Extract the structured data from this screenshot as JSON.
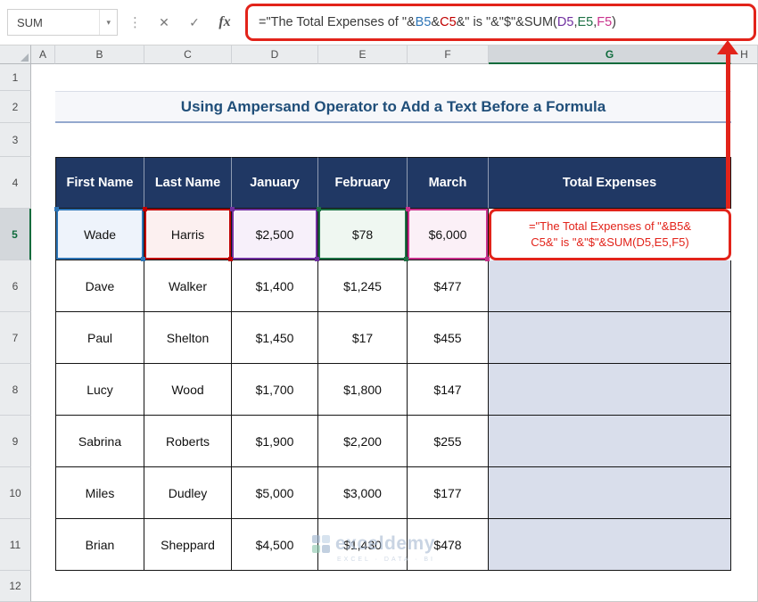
{
  "formula_bar": {
    "name_box_value": "SUM",
    "name_box_caret": "▾",
    "separator_dots": "⋮",
    "cancel_icon": "✕",
    "enter_icon": "✓",
    "fx_icon": "fx",
    "formula_segments": [
      {
        "text": "=\"The Total Expenses of \"&",
        "color": "plain"
      },
      {
        "text": "B5",
        "color": "blue"
      },
      {
        "text": "&",
        "color": "plain"
      },
      {
        "text": "C5",
        "color": "red"
      },
      {
        "text": "&\" is \"&\"$\"&SUM(",
        "color": "plain"
      },
      {
        "text": "D5",
        "color": "purple"
      },
      {
        "text": ",",
        "color": "plain"
      },
      {
        "text": "E5",
        "color": "green"
      },
      {
        "text": ",",
        "color": "plain"
      },
      {
        "text": "F5",
        "color": "magenta"
      },
      {
        "text": ")",
        "color": "plain"
      }
    ]
  },
  "sheet": {
    "col_headers": [
      "A",
      "B",
      "C",
      "D",
      "E",
      "F",
      "G",
      "H"
    ],
    "row_headers": [
      "1",
      "2",
      "3",
      "4",
      "5",
      "6",
      "7",
      "8",
      "9",
      "10",
      "11",
      "12"
    ],
    "selected_column": "G",
    "selected_row": "5",
    "title": "Using Ampersand Operator to Add a Text Before a Formula",
    "table": {
      "headers": [
        "First Name",
        "Last Name",
        "January",
        "February",
        "March",
        "Total Expenses"
      ],
      "rows": [
        {
          "first": "Wade",
          "last": "Harris",
          "january": "$2,500",
          "february": "$78",
          "march": "$6,000"
        },
        {
          "first": "Dave",
          "last": "Walker",
          "january": "$1,400",
          "february": "$1,245",
          "march": "$477"
        },
        {
          "first": "Paul",
          "last": "Shelton",
          "january": "$1,450",
          "february": "$17",
          "march": "$455"
        },
        {
          "first": "Lucy",
          "last": "Wood",
          "january": "$1,700",
          "february": "$1,800",
          "march": "$147"
        },
        {
          "first": "Sabrina",
          "last": "Roberts",
          "january": "$1,900",
          "february": "$2,200",
          "march": "$255"
        },
        {
          "first": "Miles",
          "last": "Dudley",
          "january": "$5,000",
          "february": "$3,000",
          "march": "$177"
        },
        {
          "first": "Brian",
          "last": "Sheppard",
          "january": "$4,500",
          "february": "$1,430",
          "march": "$478"
        }
      ]
    },
    "g5_cell": {
      "line1": "=\"The Total Expenses of \"&B5&",
      "line2": "C5&\" is \"&\"$\"&SUM(D5,E5,F5)"
    }
  },
  "watermark": {
    "brand": "exceldemy",
    "tagline": "EXCEL · DATA · BI"
  },
  "colors": {
    "annotation_red": "#E2231A",
    "table_header_navy": "#203864",
    "title_blue": "#1F4E79",
    "g_column_fill": "#D9DEEB",
    "ref_blue": "#2E75B6",
    "ref_red": "#C00000",
    "ref_purple": "#7030A0",
    "ref_green": "#1E7145",
    "ref_magenta": "#C9318C",
    "selection_green": "#0E6B3C"
  }
}
